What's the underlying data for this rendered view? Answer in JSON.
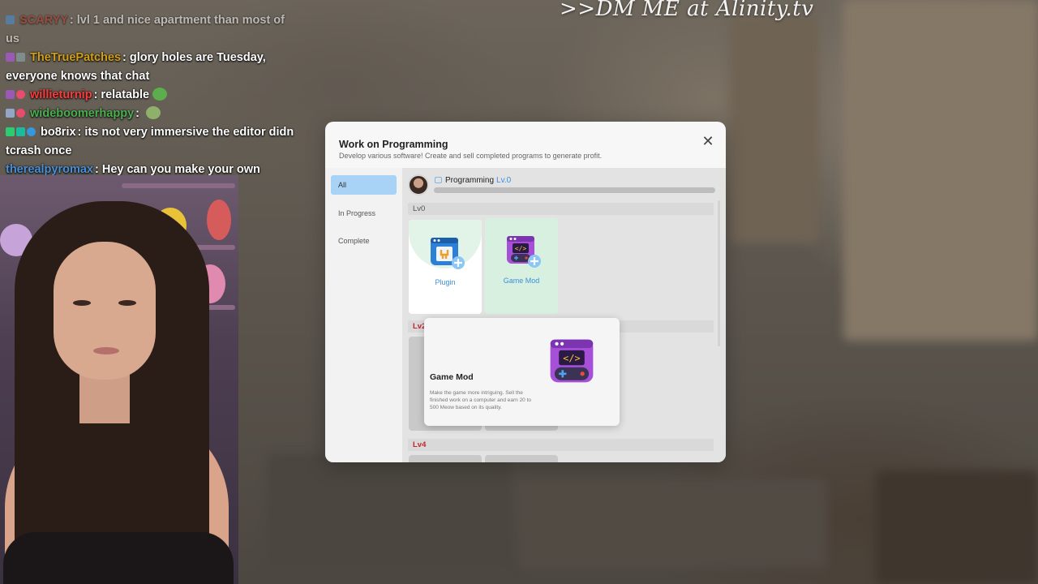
{
  "stream_overlay": {
    "promo_text": ">>DM ME at Alinity.tv"
  },
  "chat": {
    "messages": [
      {
        "user": "SCARYY",
        "user_color": "#c0392b",
        "text": "lvl 1 and nice apartment than most of us",
        "faded": true
      },
      {
        "user": "TheTruePatches",
        "user_color": "#d4a017",
        "text": "glory holes are Tuesday, everyone knows that chat",
        "faded": false
      },
      {
        "user": "willieturnip",
        "user_color": "#ff3b3b",
        "text": "relatable",
        "faded": false
      },
      {
        "user": "wideboomerhappy",
        "user_color": "#4caf50",
        "text": "",
        "faded": false
      },
      {
        "user": "bo8rix",
        "user_color": "#ffffff",
        "text": "its not very immersive the editor didn tcrash once",
        "faded": false
      },
      {
        "user": "therealpyromax",
        "user_color": "#4a90d9",
        "text": "Hey can you make your own buisness in inzoi?",
        "faded": false
      }
    ]
  },
  "dialog": {
    "title": "Work on Programming",
    "subtitle": "Develop various software! Create and sell completed programs to generate profit.",
    "close_icon": "close-icon",
    "tabs": [
      {
        "label": "All",
        "active": true
      },
      {
        "label": "In Progress",
        "active": false
      },
      {
        "label": "Complete",
        "active": false
      }
    ],
    "skill": {
      "name": "Programming",
      "level": "Lv.0",
      "progress": 0
    },
    "levels": [
      {
        "label": "Lv0"
      },
      {
        "label": "Lv2"
      },
      {
        "label": "Lv4"
      }
    ],
    "items": [
      {
        "name": "Plugin",
        "icon": "plugin-icon"
      },
      {
        "name": "Game Mod",
        "icon": "game-mod-icon"
      }
    ],
    "tooltip": {
      "title": "Game Mod",
      "icon": "game-mod-icon",
      "description": "Make the game more intriguing. Sell the finished work on a computer and earn 20 to 500 Meow based on its quality."
    }
  },
  "colors": {
    "accent_blue": "#3c8fdc",
    "level_red": "#c2262b",
    "active_tab": "#a8d3f7",
    "selected_card": "#d7f0df"
  }
}
